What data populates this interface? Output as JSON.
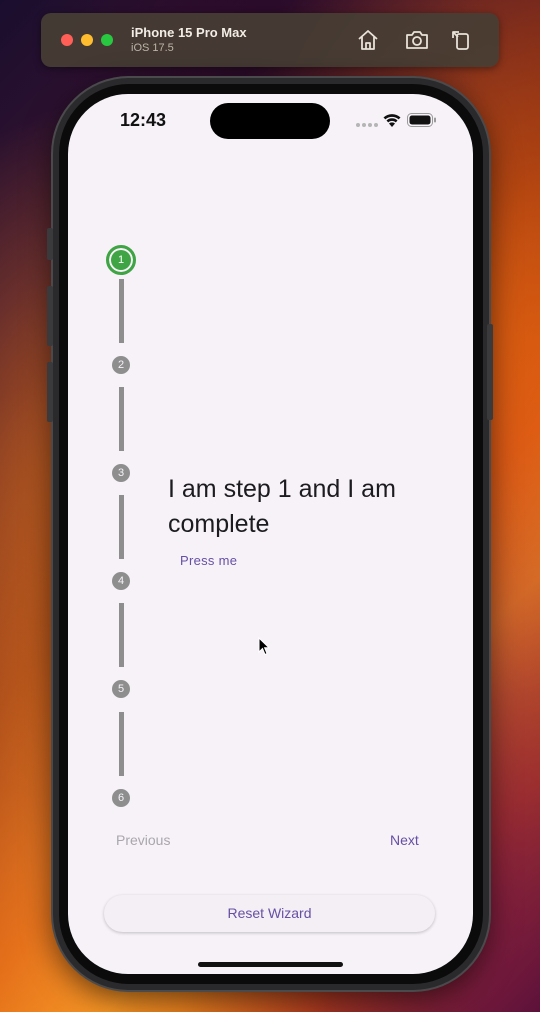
{
  "simulator": {
    "device_name": "iPhone 15 Pro Max",
    "os_version": "iOS 17.5",
    "toolbar_icons": [
      "home-icon",
      "screenshot-icon",
      "rotate-icon"
    ]
  },
  "status_bar": {
    "time": "12:43",
    "icons": [
      "signal-dots-icon",
      "wifi-icon",
      "battery-icon"
    ]
  },
  "stepper": {
    "steps": [
      {
        "number": "1",
        "state": "active"
      },
      {
        "number": "2",
        "state": "inactive"
      },
      {
        "number": "3",
        "state": "inactive"
      },
      {
        "number": "4",
        "state": "inactive"
      },
      {
        "number": "5",
        "state": "inactive"
      },
      {
        "number": "6",
        "state": "inactive"
      }
    ],
    "content_text": "I am step 1 and I am complete",
    "press_me_label": "Press me",
    "previous_label": "Previous",
    "next_label": "Next"
  },
  "reset_label": "Reset Wizard",
  "colors": {
    "accent": "#6750a4",
    "active_step": "#3fa444",
    "inactive_step": "#8e8e8e",
    "screen_background": "#f6f2f8",
    "disabled_text": "#a9a6ad"
  }
}
